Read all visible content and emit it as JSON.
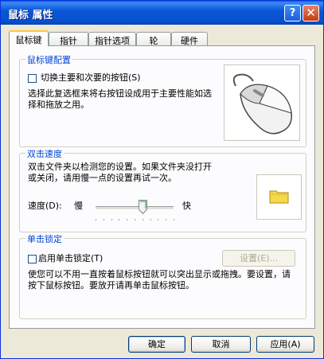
{
  "window": {
    "title": "鼠标 属性"
  },
  "titlebar": {
    "help_glyph": "?",
    "close_glyph": "✕"
  },
  "tabs": [
    {
      "label": "鼠标键",
      "active": true
    },
    {
      "label": "指针",
      "active": false
    },
    {
      "label": "指针选项",
      "active": false
    },
    {
      "label": "轮",
      "active": false
    },
    {
      "label": "硬件",
      "active": false
    }
  ],
  "button_config": {
    "title": "鼠标键配置",
    "swap_checkbox_label": "切换主要和次要的按钮(S)",
    "swap_checked": false,
    "description": "选择此复选框来将右按钮设成用于主要性能如选择和拖放之用。"
  },
  "double_click": {
    "title": "双击速度",
    "description": "双击文件夹以检测您的设置。如果文件夹没打开或关闭，请用慢一点的设置再试一次。",
    "speed_label": "速度(D):",
    "slow_label": "慢",
    "fast_label": "快",
    "speed_value": 0.6
  },
  "click_lock": {
    "title": "单击锁定",
    "checkbox_label": "启用单击锁定(T)",
    "checked": false,
    "settings_button": "设置(E)...",
    "description": "使您可以不用一直按着鼠标按钮就可以突出显示或拖拽。要设置，请按下鼠标按钮。要放开请再单击鼠标按钮。"
  },
  "footer": {
    "ok": "确定",
    "cancel": "取消",
    "apply": "应用(A)"
  },
  "colors": {
    "titlebar": "#0a58d6",
    "group_title": "#0046d5",
    "dialog_bg": "#ece9d8",
    "folder": "#f5d94a"
  }
}
